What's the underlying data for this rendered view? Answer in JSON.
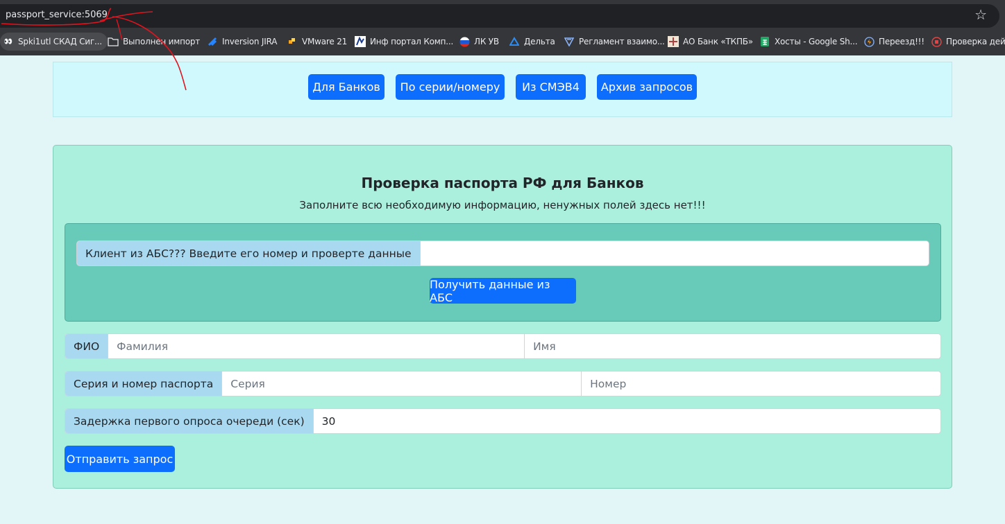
{
  "browser": {
    "url": "passport_service:5069",
    "bookmarks": [
      {
        "label": "Spki1utl СКАД Сиг...",
        "icon": "eyes-icon"
      },
      {
        "label": "Выполнен импорт",
        "icon": "folder-icon"
      },
      {
        "label": "Inversion JIRA",
        "icon": "jira-icon"
      },
      {
        "label": "VMware 21",
        "icon": "vmware-icon"
      },
      {
        "label": "Инф портал Комп...",
        "icon": "portal-icon"
      },
      {
        "label": "ЛК УВ",
        "icon": "flag-icon"
      },
      {
        "label": "Дельта",
        "icon": "delta-icon"
      },
      {
        "label": "Регламент взаимо...",
        "icon": "reglament-icon"
      },
      {
        "label": "АО Банк «ТКПБ»",
        "icon": "bank-icon"
      },
      {
        "label": "Хосты - Google Sh...",
        "icon": "sheets-icon"
      },
      {
        "label": "Переезд!!!",
        "icon": "bolt-icon"
      },
      {
        "label": "Проверка дейст...",
        "icon": "check-icon"
      }
    ]
  },
  "nav": {
    "buttons": [
      "Для Банков",
      "По серии/номеру",
      "Из СМЭВ4",
      "Архив запросов"
    ]
  },
  "form": {
    "title": "Проверка паспорта РФ для Банков",
    "subtitle": "Заполните всю необходимую информацию, ненужных полей здесь нет!!!",
    "abs": {
      "label": "Клиент из АБС??? Введите его номер и проверте данные",
      "value": "",
      "button": "Получить данные из АБС"
    },
    "fio": {
      "label": "ФИО",
      "surname_placeholder": "Фамилия",
      "name_placeholder": "Имя"
    },
    "passport": {
      "label": "Серия и номер паспорта",
      "series_placeholder": "Серия",
      "number_placeholder": "Номер"
    },
    "delay": {
      "label": "Задержка первого опроса очереди (сек)",
      "value": "30"
    },
    "submit": "Отправить запрос"
  },
  "colors": {
    "primary": "#0d6efd",
    "nav_panel_bg": "#cff9fd",
    "card_bg": "#abefdd",
    "abs_box_bg": "#68cab9",
    "addon_bg": "#a9d9f0"
  }
}
